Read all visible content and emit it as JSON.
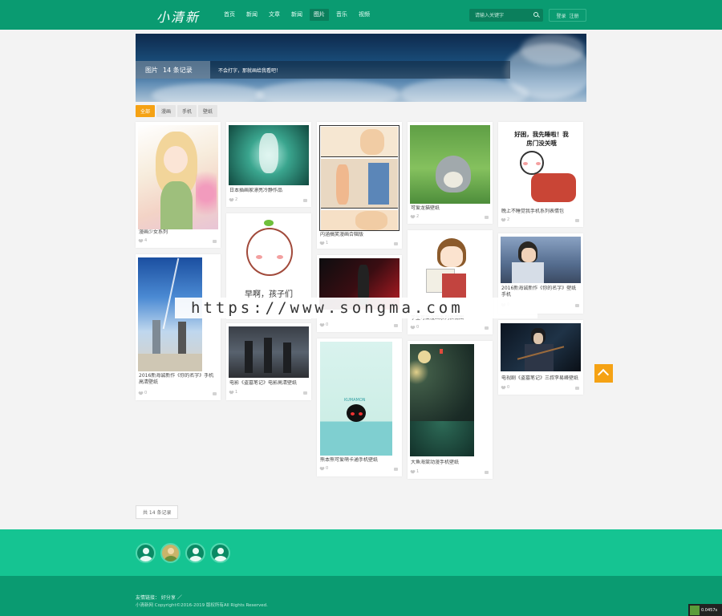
{
  "header": {
    "logo": "小清新",
    "nav": [
      "首页",
      "新闻",
      "文章",
      "新闻",
      "图片",
      "音乐",
      "视频"
    ],
    "active_nav_index": 4,
    "search_placeholder": "请输入关键字",
    "login": "登录",
    "register": "注册"
  },
  "banner": {
    "title": "图片",
    "count": "14 条记录",
    "desc": "不会打字，那就画给我看吧！"
  },
  "filters": [
    "全部",
    "漫画",
    "手机",
    "壁纸"
  ],
  "active_filter_index": 0,
  "cards": [
    {
      "title": "漫画少女系列",
      "likes": "4"
    },
    {
      "title": "2016新海诚新作《你的名字》手机高清壁纸",
      "likes": "0"
    },
    {
      "title": "日本插画家漂亮冷静作品",
      "likes": "2"
    },
    {
      "title": "早安，孩子们",
      "likes": "0"
    },
    {
      "title": "电影《盗墓笔记》电影高清壁纸",
      "likes": "1"
    },
    {
      "title": "内涵搞笑漫画合辑版",
      "likes": "1"
    },
    {
      "title": "",
      "likes": "0"
    },
    {
      "title": "熊本熊可爱萌卡通手机壁纸",
      "likes": "0"
    },
    {
      "title": "可爱龙猫壁纸",
      "likes": "2"
    },
    {
      "title": "学生可爱漫画系列表情图",
      "likes": "0"
    },
    {
      "title": "大鱼海棠动漫手机壁纸",
      "likes": "1"
    },
    {
      "title": "晚上不睡觉我手机系列表情包",
      "likes": "2"
    },
    {
      "title": "2016新海诚新作《你的名字》壁纸手机",
      "likes": "0"
    },
    {
      "title": "电视剧《盗墓笔记》三叔李易峰壁纸",
      "likes": "0"
    }
  ],
  "comic_text": "好困，我先睡啦！我房门没关哦",
  "morning_text": "早啊，孩子们",
  "kumamon_text": "KUMAMON",
  "watermark": "https://www.songma.com",
  "total": "共 14 条记录",
  "footer": {
    "friend_links": "友情链接： 好分享 ／",
    "copyright": "小清新网 Copyright©2016-2019 版权所有All Rights Reserved."
  },
  "speed": "0.0457s"
}
